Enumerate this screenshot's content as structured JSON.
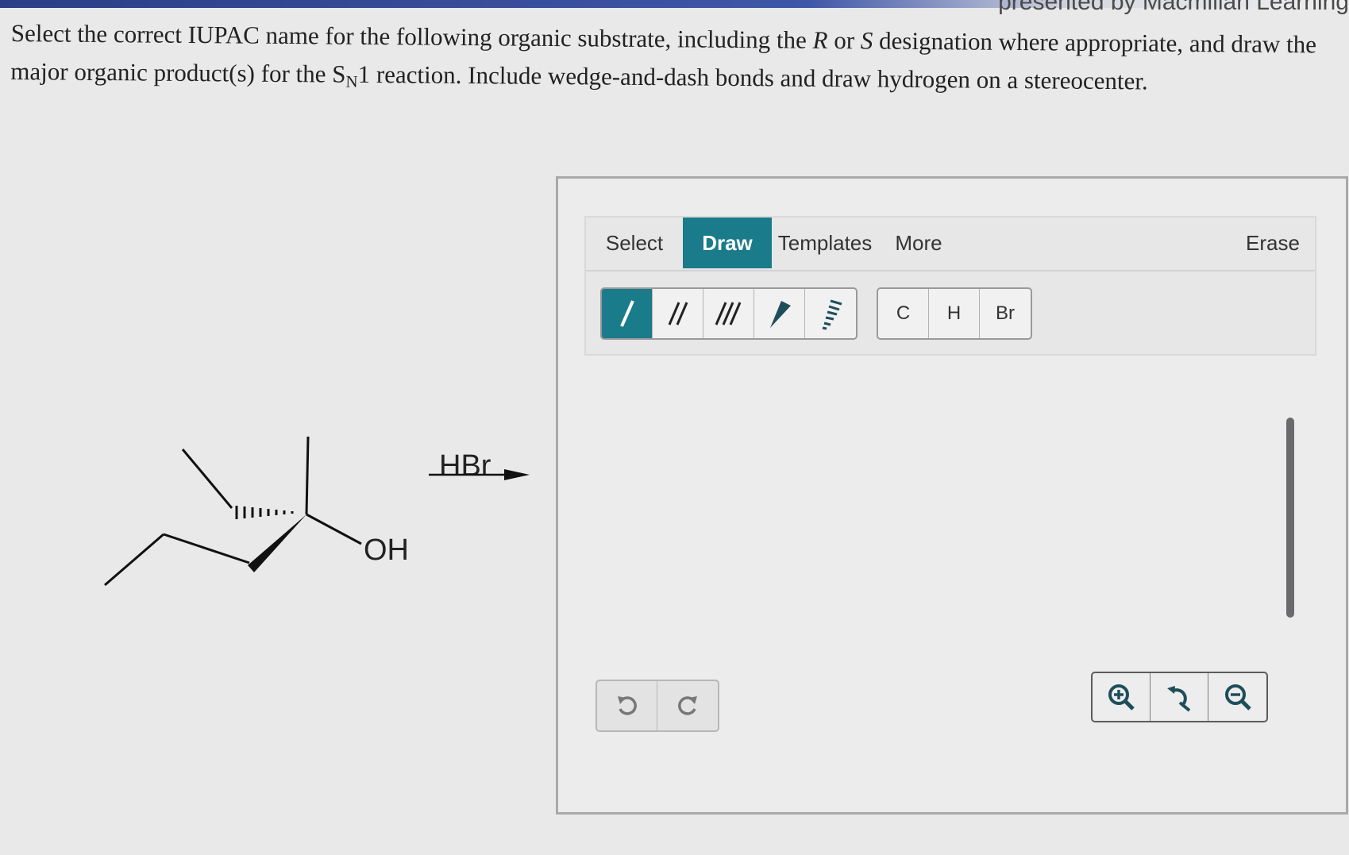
{
  "header": {
    "brand_text": "presented by Macmillan Learning"
  },
  "question": {
    "text_part1": "Select the correct IUPAC name for the following organic substrate, including the ",
    "r_letter": "R",
    "text_or": " or ",
    "s_letter": "S",
    "text_part2": " designation where appropriate, and draw the major organic product(s) for the S",
    "subscript": "N",
    "text_part3": "1 reaction. Include wedge-and-dash bonds and draw hydrogen on a stereocenter."
  },
  "reaction": {
    "reagent": "HBr",
    "substituent_label": "OH"
  },
  "editor": {
    "tabs": [
      {
        "label": "Select",
        "active": false
      },
      {
        "label": "Draw",
        "active": true
      },
      {
        "label": "Templates",
        "active": false
      },
      {
        "label": "More",
        "active": false
      }
    ],
    "erase_label": "Erase",
    "bond_tools": [
      {
        "icon": "single-bond-icon",
        "active": true
      },
      {
        "icon": "double-bond-icon",
        "active": false
      },
      {
        "icon": "triple-bond-icon",
        "active": false
      },
      {
        "icon": "wedge-bond-icon",
        "active": false
      },
      {
        "icon": "dash-bond-icon",
        "active": false
      }
    ],
    "atoms": [
      "C",
      "H",
      "Br"
    ],
    "accent_color": "#1a7b8a"
  }
}
